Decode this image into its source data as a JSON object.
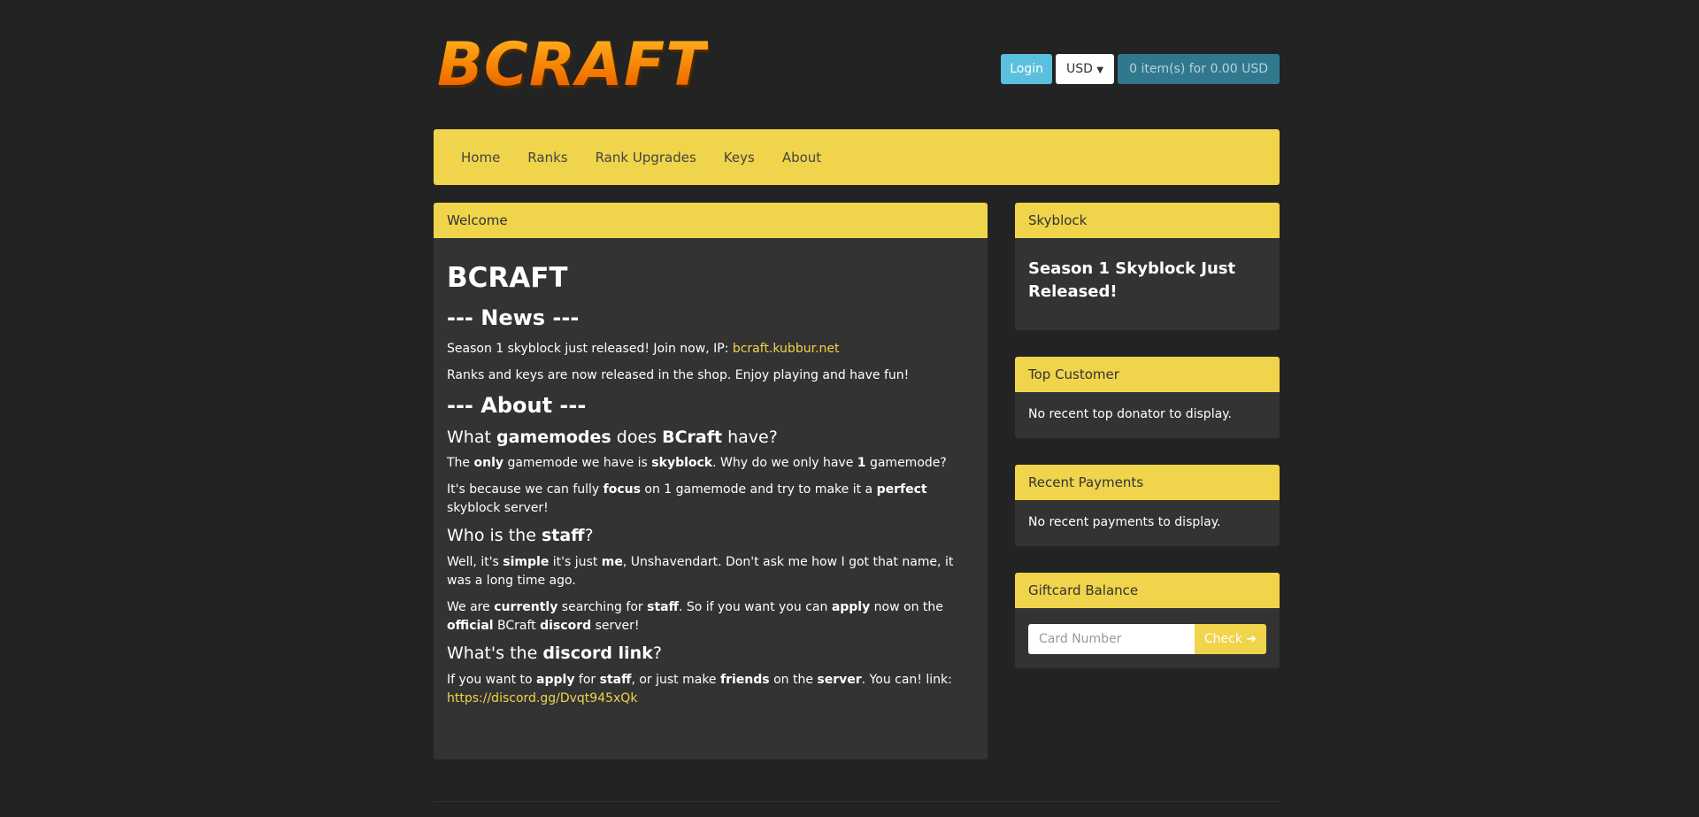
{
  "header": {
    "logo_text": "BCRAFT",
    "login_label": "Login",
    "currency_label": "USD",
    "cart_label": "0 item(s) for 0.00 USD"
  },
  "nav": {
    "items": [
      "Home",
      "Ranks",
      "Rank Upgrades",
      "Keys",
      "About"
    ]
  },
  "welcome": {
    "heading": "Welcome",
    "title": "BCRAFT",
    "news_heading": "--- News ---",
    "news_1_text": "Season 1 skyblock just released! Join now, IP: ",
    "news_1_link": "bcraft.kubbur.net",
    "news_2_text": "Ranks and keys are now released in the shop. Enjoy playing and have fun!",
    "about_heading": "--- About ---",
    "q1": {
      "a": "What ",
      "b": "gamemodes",
      "c": " does ",
      "d": "BCraft",
      "e": " have?"
    },
    "p1": {
      "a": "The ",
      "b": "only",
      "c": " gamemode we have is ",
      "d": "skyblock",
      "e": ". Why do we only have ",
      "f": "1",
      "g": " gamemode?"
    },
    "p2": {
      "a": "It's because we can fully ",
      "b": "focus",
      "c": " on 1 gamemode and try to make it a ",
      "d": "perfect",
      "e": " skyblock server!"
    },
    "q2": {
      "a": "Who is the ",
      "b": "staff",
      "c": "?"
    },
    "p3": {
      "a": "Well, it's ",
      "b": "simple",
      "c": " it's just ",
      "d": "me",
      "e": ", Unshavendart. Don't ask me how I got that name, it was a long time ago."
    },
    "p4": {
      "a": "We are ",
      "b": "currently",
      "c": " searching for ",
      "d": "staff",
      "e": ". So if you want you can ",
      "f": "apply",
      "g": " now on the ",
      "h": "official",
      "i": " BCraft ",
      "j": "discord",
      "k": " server!"
    },
    "q3": {
      "a": "What's the ",
      "b": "discord link",
      "c": "?"
    },
    "p5": {
      "a": "If you want to ",
      "b": "apply",
      "c": " for ",
      "d": "staff",
      "e": ", or just make ",
      "f": "friends",
      "g": " on the ",
      "h": "server",
      "i": ". You can! link: ",
      "link": "https://discord.gg/Dvqt945xQk"
    }
  },
  "skyblock": {
    "heading": "Skyblock",
    "title": "Season 1 Skyblock Just Released!"
  },
  "top_customer": {
    "heading": "Top Customer",
    "text": "No recent top donator to display."
  },
  "recent_payments": {
    "heading": "Recent Payments",
    "text": "No recent payments to display."
  },
  "giftcard": {
    "heading": "Giftcard Balance",
    "placeholder": "Card Number",
    "button_label": "Check",
    "button_icon": "arrow-right-icon"
  },
  "colors": {
    "background": "#232323",
    "panel": "#333333",
    "accent": "#f0d44b",
    "login": "#5bc0de",
    "cart": "#31788f"
  }
}
